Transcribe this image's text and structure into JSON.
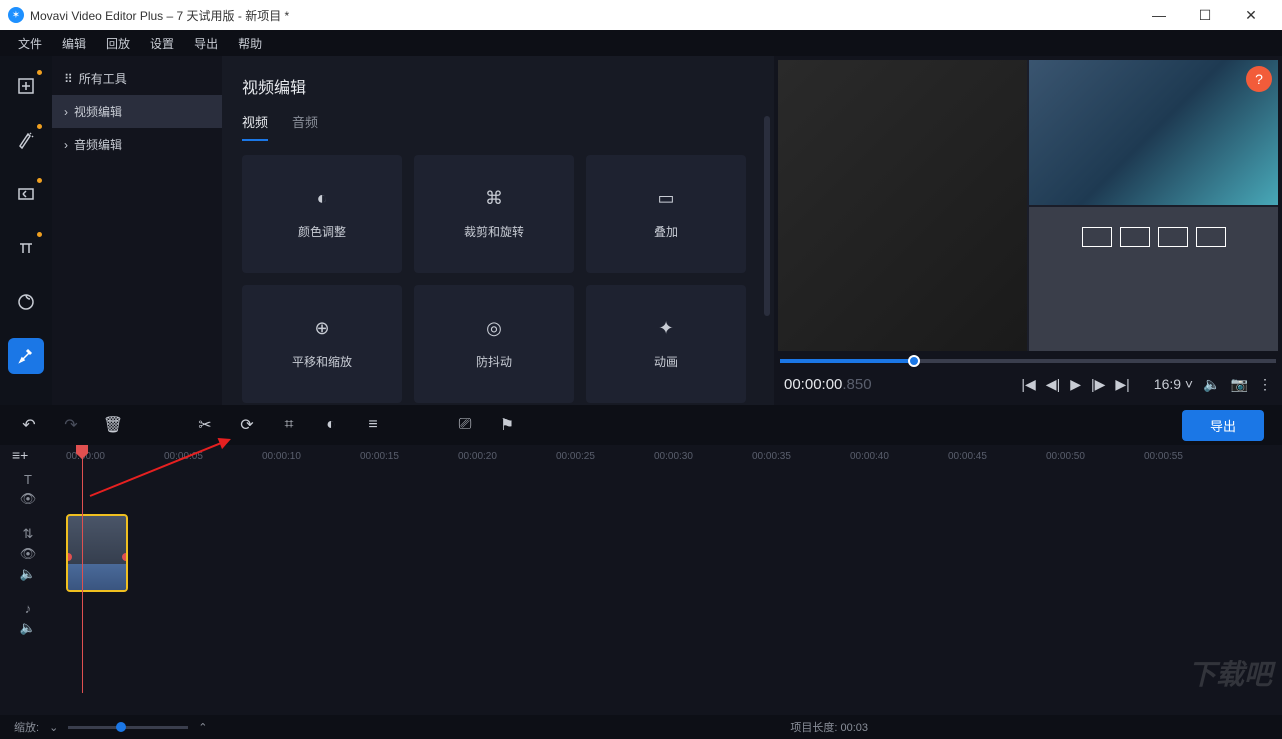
{
  "titlebar": {
    "app": "Movavi Video Editor Plus – 7 天试用版 - 新项目 *"
  },
  "menu": [
    "文件",
    "编辑",
    "回放",
    "设置",
    "导出",
    "帮助"
  ],
  "sidebar": {
    "items": [
      {
        "label": "所有工具",
        "icon": "⠿"
      },
      {
        "label": "视频编辑",
        "icon": "›"
      },
      {
        "label": "音频编辑",
        "icon": "›"
      }
    ]
  },
  "center": {
    "title": "视频编辑",
    "tabs": [
      "视频",
      "音频"
    ],
    "cards": [
      "颜色调整",
      "裁剪和旋转",
      "叠加",
      "平移和缩放",
      "防抖动",
      "动画"
    ]
  },
  "preview": {
    "help": "?",
    "time": "00:00:00",
    "time_ms": ".850",
    "aspect": "16:9"
  },
  "toolbar": {
    "export": "导出"
  },
  "ruler": [
    "00:00:00",
    "00:00:05",
    "00:00:10",
    "00:00:15",
    "00:00:20",
    "00:00:25",
    "00:00:30",
    "00:00:35",
    "00:00:40",
    "00:00:45",
    "00:00:50",
    "00:00:55"
  ],
  "zoom": {
    "label": "缩放:",
    "project_label": "项目长度:",
    "project_value": "00:03"
  },
  "watermark": "下载吧"
}
